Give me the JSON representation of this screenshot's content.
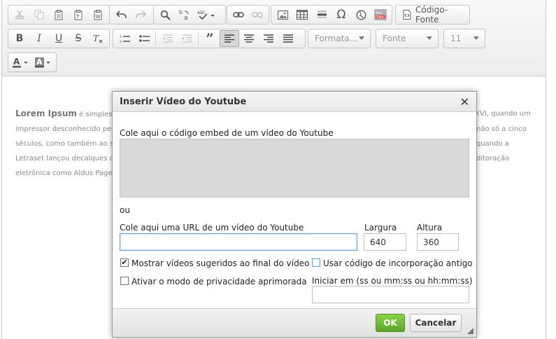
{
  "toolbar": {
    "source_label": "Código-Fonte",
    "format_combo": "Formata...",
    "font_combo": "Fonte",
    "size_combo": "11",
    "icons": [
      "cut-icon",
      "copy-icon",
      "paste-icon",
      "paste-text-icon",
      "paste-word-icon",
      "undo-icon",
      "redo-icon",
      "find-icon",
      "replace-icon",
      "spellcheck-icon",
      "link-icon",
      "unlink-icon",
      "image-icon",
      "table-icon",
      "horizontal-rule-icon",
      "special-char-icon",
      "iframe-icon",
      "youtube-icon",
      "source-icon",
      "bold-icon",
      "italic-icon",
      "underline-icon",
      "strike-icon",
      "remove-format-icon",
      "numbered-list-icon",
      "bullet-list-icon",
      "outdent-icon",
      "indent-icon",
      "blockquote-icon",
      "align-left-icon",
      "align-center-icon",
      "align-right-icon",
      "justify-icon",
      "text-color-icon",
      "bg-color-icon"
    ]
  },
  "editor": {
    "lead": "Lorem Ipsum",
    "line1_left": " é simplesm",
    "line1_right": "XVI, quando um",
    "line2_left": "impressor desconhecido peg",
    "line2_right": "não só a cinco",
    "line3_left": "séculos, como também ao sa",
    "line3_right": "quando a",
    "line4_left": "Letraset lançou decalques c",
    "line4_right": "ditoração",
    "line5_left": "eletrônica como Aldus Pagel"
  },
  "dialog": {
    "title": "Inserir Vídeo do Youtube",
    "close_symbol": "✕",
    "embed_label": "Cole aqui o código embed de um vídeo do Youtube",
    "embed_value": "",
    "or_label": "ou",
    "url_label": "Cole aqui uma URL de um vídeo do Youtube",
    "url_value": "",
    "width_label": "Largura",
    "width_value": "640",
    "height_label": "Altura",
    "height_value": "360",
    "suggested_label": "Mostrar vídeos sugeridos ao final do vídeo",
    "suggested_checked": true,
    "old_embed_label": "Usar código de incorporação antigo",
    "old_embed_checked": false,
    "privacy_label": "Ativar o modo de privacidade aprimorada",
    "privacy_checked": false,
    "start_label": "Iniciar em (ss ou mm:ss ou hh:mm:ss)",
    "start_value": "",
    "ok_label": "OK",
    "cancel_label": "Cancelar"
  },
  "colors": {
    "ok_green": "#6cb832",
    "focus_blue": "#6e9ecf"
  }
}
